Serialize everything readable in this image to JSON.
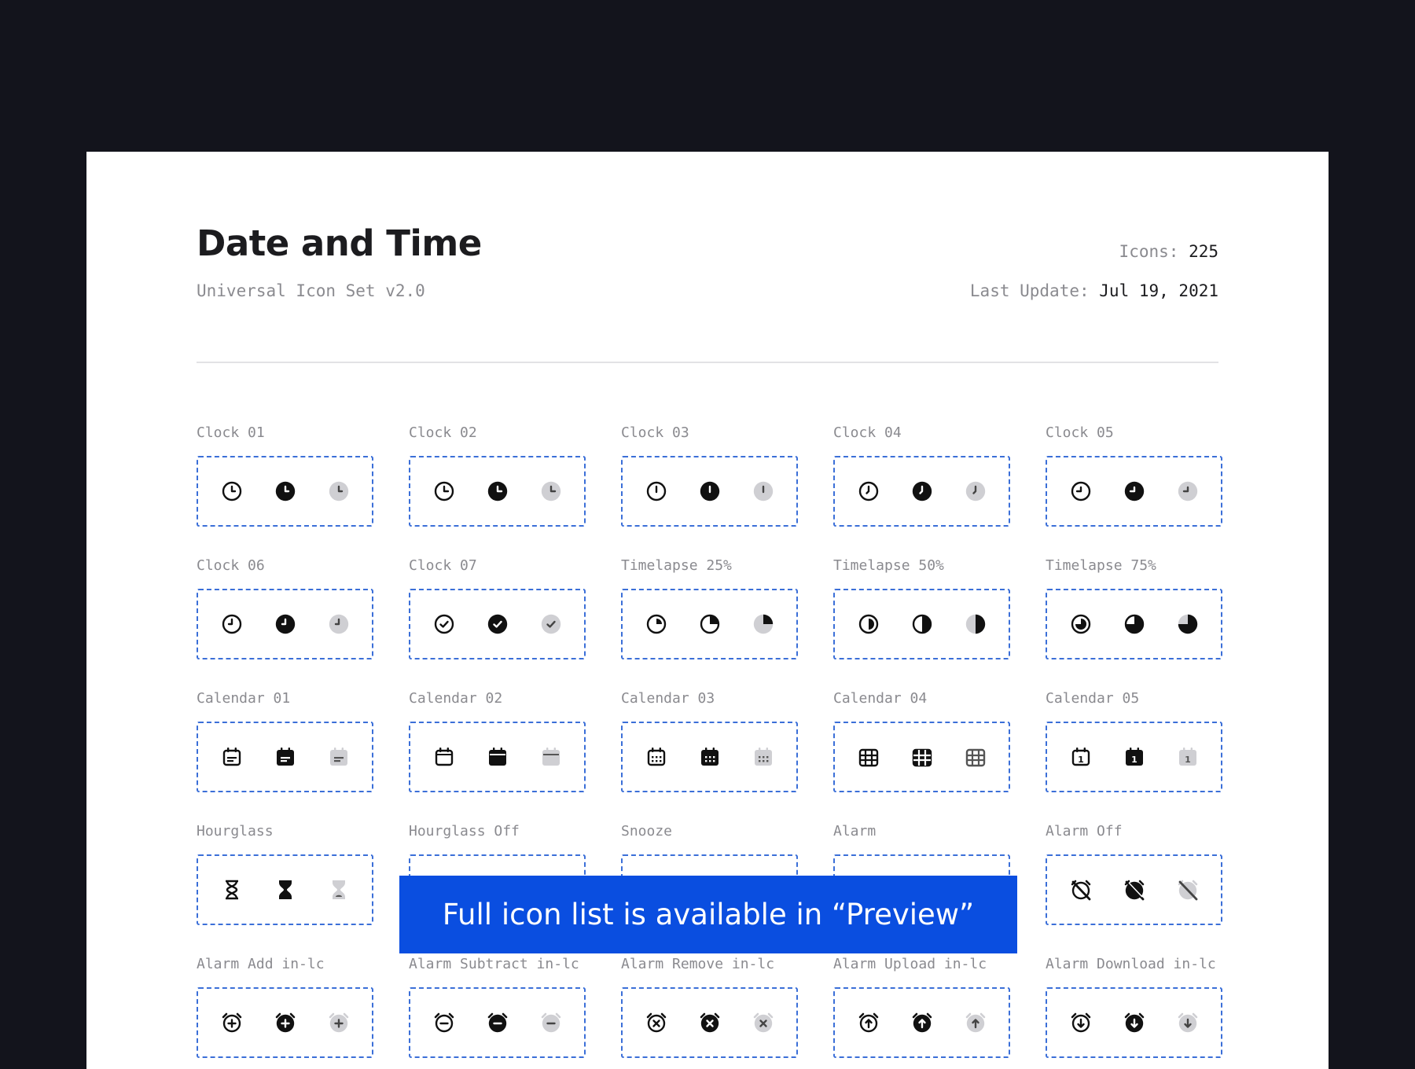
{
  "header": {
    "title": "Date and Time",
    "subtitle": "Universal Icon Set v2.0",
    "icons_label": "Icons:",
    "icons_value": "225",
    "update_label": "Last Update:",
    "update_value": "Jul 19, 2021"
  },
  "banner": {
    "text": "Full icon list is available in “Preview”"
  },
  "colors": {
    "box_border": "#3b6fd8",
    "banner_bg": "#0a4ee0",
    "icon_dark": "#111111",
    "icon_muted": "#cfcfd3"
  },
  "icon_groups": [
    {
      "label": "Clock 01",
      "icon": "clock-icon"
    },
    {
      "label": "Clock 02",
      "icon": "clock-icon"
    },
    {
      "label": "Clock 03",
      "icon": "clock-icon"
    },
    {
      "label": "Clock 04",
      "icon": "clock-icon"
    },
    {
      "label": "Clock 05",
      "icon": "clock-icon"
    },
    {
      "label": "Clock 06",
      "icon": "clock-icon"
    },
    {
      "label": "Clock 07",
      "icon": "clock-check-icon"
    },
    {
      "label": "Timelapse 25%",
      "icon": "timelapse-icon"
    },
    {
      "label": "Timelapse 50%",
      "icon": "timelapse-icon"
    },
    {
      "label": "Timelapse 75%",
      "icon": "timelapse-icon"
    },
    {
      "label": "Calendar 01",
      "icon": "calendar-icon"
    },
    {
      "label": "Calendar 02",
      "icon": "calendar-icon"
    },
    {
      "label": "Calendar 03",
      "icon": "calendar-icon"
    },
    {
      "label": "Calendar 04",
      "icon": "calendar-grid-icon"
    },
    {
      "label": "Calendar 05",
      "icon": "calendar-icon"
    },
    {
      "label": "Hourglass",
      "icon": "hourglass-icon"
    },
    {
      "label": "Hourglass Off",
      "icon": "hourglass-off-icon"
    },
    {
      "label": "Snooze",
      "icon": "snooze-icon"
    },
    {
      "label": "Alarm",
      "icon": "alarm-icon"
    },
    {
      "label": "Alarm Off",
      "icon": "alarm-off-icon"
    },
    {
      "label": "Alarm Add in-lc",
      "icon": "alarm-add-icon"
    },
    {
      "label": "Alarm Subtract in-lc",
      "icon": "alarm-subtract-icon"
    },
    {
      "label": "Alarm Remove in-lc",
      "icon": "alarm-remove-icon"
    },
    {
      "label": "Alarm Upload in-lc",
      "icon": "alarm-upload-icon"
    },
    {
      "label": "Alarm Download in-lc",
      "icon": "alarm-download-icon"
    }
  ]
}
